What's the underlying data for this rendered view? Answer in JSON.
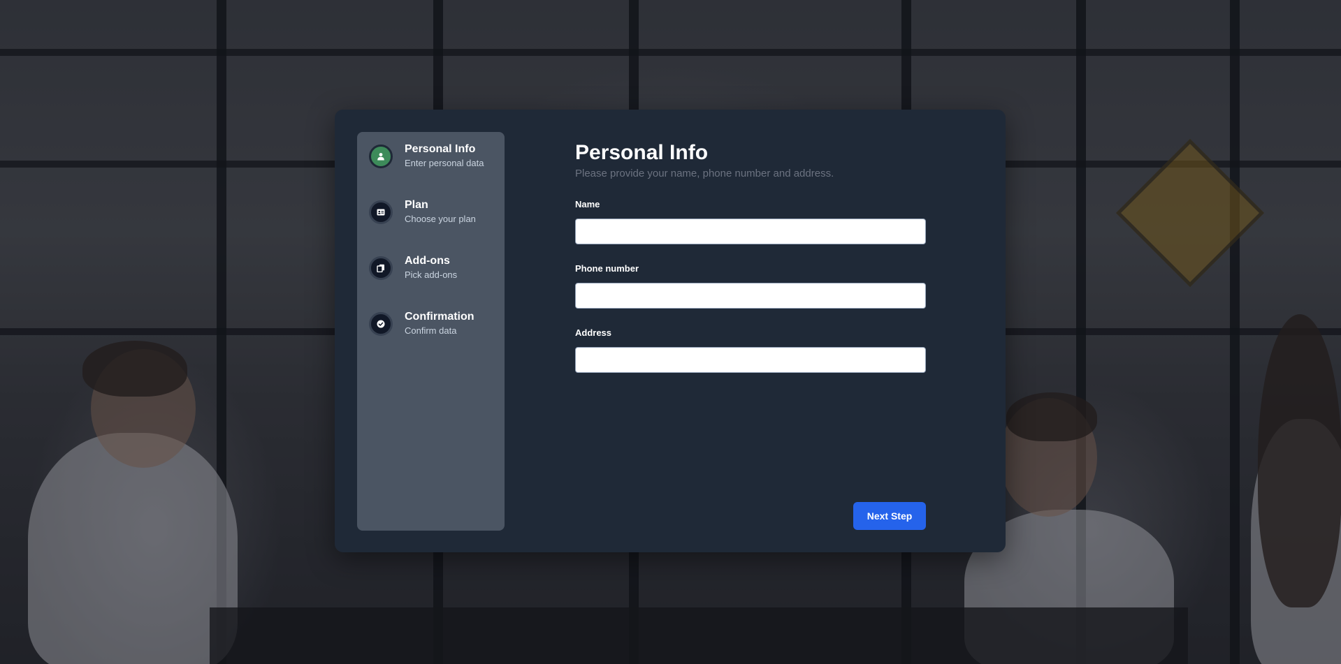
{
  "sidebar": {
    "steps": [
      {
        "title": "Personal Info",
        "subtitle": "Enter personal data",
        "icon": "user-icon",
        "active": true
      },
      {
        "title": "Plan",
        "subtitle": "Choose your plan",
        "icon": "id-card-icon",
        "active": false
      },
      {
        "title": "Add-ons",
        "subtitle": "Pick add-ons",
        "icon": "copy-icon",
        "active": false
      },
      {
        "title": "Confirmation",
        "subtitle": "Confirm data",
        "icon": "check-circle-icon",
        "active": false
      }
    ]
  },
  "main": {
    "title": "Personal Info",
    "description": "Please provide your name, phone number and address.",
    "fields": [
      {
        "label": "Name",
        "value": "",
        "placeholder": ""
      },
      {
        "label": "Phone number",
        "value": "",
        "placeholder": ""
      },
      {
        "label": "Address",
        "value": "",
        "placeholder": ""
      }
    ],
    "next_label": "Next Step"
  },
  "colors": {
    "card_bg": "#1f2937",
    "sidebar_bg": "#4b5563",
    "active_step": "#3d8b5a",
    "button": "#2563eb"
  }
}
